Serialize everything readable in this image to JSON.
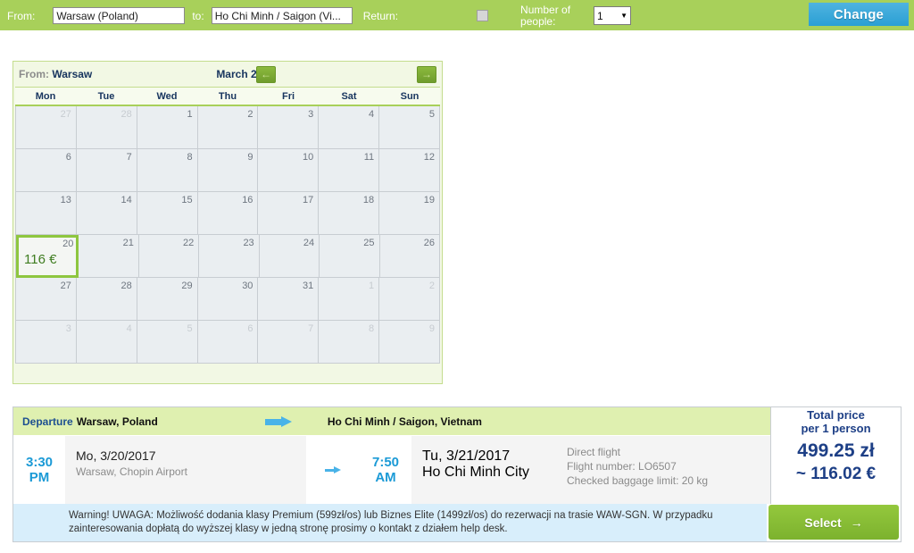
{
  "searchbar": {
    "from_label": "From:",
    "from_value": "Warsaw (Poland)",
    "to_label": "to:",
    "to_value": "Ho Chi Minh / Saigon (Vi...",
    "return_label": "Return:",
    "people_label": "Number of people:",
    "people_value": "1",
    "people_caret": "▼",
    "change_label": "Change"
  },
  "calendar": {
    "origin_prefix": "From: ",
    "origin_city": "Warsaw",
    "prev_icon": "←",
    "next_icon": "→",
    "month_label": "March 2017",
    "dow": [
      "Mon",
      "Tue",
      "Wed",
      "Thu",
      "Fri",
      "Sat",
      "Sun"
    ],
    "weeks": [
      [
        {
          "num": "27",
          "out": true
        },
        {
          "num": "28",
          "out": true
        },
        {
          "num": "1"
        },
        {
          "num": "2"
        },
        {
          "num": "3"
        },
        {
          "num": "4"
        },
        {
          "num": "5"
        }
      ],
      [
        {
          "num": "6"
        },
        {
          "num": "7"
        },
        {
          "num": "8"
        },
        {
          "num": "9"
        },
        {
          "num": "10"
        },
        {
          "num": "11"
        },
        {
          "num": "12"
        }
      ],
      [
        {
          "num": "13"
        },
        {
          "num": "14"
        },
        {
          "num": "15"
        },
        {
          "num": "16"
        },
        {
          "num": "17"
        },
        {
          "num": "18"
        },
        {
          "num": "19"
        }
      ],
      [
        {
          "num": "20",
          "price": "116 €",
          "selected": true
        },
        {
          "num": "21"
        },
        {
          "num": "22"
        },
        {
          "num": "23"
        },
        {
          "num": "24"
        },
        {
          "num": "25"
        },
        {
          "num": "26"
        }
      ],
      [
        {
          "num": "27"
        },
        {
          "num": "28"
        },
        {
          "num": "29"
        },
        {
          "num": "30"
        },
        {
          "num": "31"
        },
        {
          "num": "1",
          "out": true
        },
        {
          "num": "2",
          "out": true
        }
      ],
      [
        {
          "num": "3",
          "out": true
        },
        {
          "num": "4",
          "out": true
        },
        {
          "num": "5",
          "out": true
        },
        {
          "num": "6",
          "out": true
        },
        {
          "num": "7",
          "out": true
        },
        {
          "num": "8",
          "out": true
        },
        {
          "num": "9",
          "out": true
        }
      ]
    ]
  },
  "result": {
    "departure_label": "Departure",
    "origin": "Warsaw, Poland",
    "destination": "Ho Chi Minh / Saigon, Vietnam",
    "price_header_line1": "Total price",
    "price_header_line2": "per 1 person",
    "depart_time": "3:30",
    "depart_meridiem": "PM",
    "depart_date": "Mo, 3/20/2017",
    "depart_airport": "Warsaw, Chopin Airport",
    "arrive_time": "7:50",
    "arrive_meridiem": "AM",
    "arrive_date": "Tu, 3/21/2017",
    "arrive_airport": "Ho Chi Minh City",
    "info_line1": "Direct flight",
    "info_line2": "Flight number: LO6507",
    "info_line3": "Checked baggage limit: 20 kg",
    "price_pln": "499.25 zł",
    "price_eur": "~ 116.02 €",
    "warning": "Warning! UWAGA: Możliwość dodania klasy Premium (599zł/os) lub Biznes Elite (1499zł/os) do rezerwacji na trasie WAW-SGN. W przypadku zainteresowania dopłatą do wyższej klasy w jedną stronę prosimy o kontakt z działem help desk.",
    "select_label": "Select",
    "select_arrow": "→"
  },
  "colors": {
    "bar_green": "#a8d05a",
    "accent_blue": "#2a9fd4",
    "calendar_bg": "#f2f8e4",
    "select_green": "#8ec63f",
    "navy": "#1d3f86"
  }
}
